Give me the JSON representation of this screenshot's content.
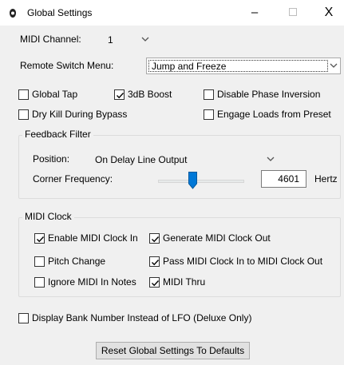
{
  "window": {
    "title": "Global Settings",
    "min_symbol": "–",
    "close_symbol": "X"
  },
  "midi_channel": {
    "label": "MIDI Channel:",
    "value": "1"
  },
  "remote_switch": {
    "label": "Remote Switch Menu:",
    "value": "Jump and Freeze"
  },
  "checkboxes": {
    "global_tap": {
      "label": "Global Tap",
      "checked": false
    },
    "boost_3db": {
      "label": "3dB Boost",
      "checked": true
    },
    "disable_phase": {
      "label": "Disable Phase Inversion",
      "checked": false
    },
    "dry_kill": {
      "label": "Dry Kill During Bypass",
      "checked": false
    },
    "engage_loads": {
      "label": "Engage Loads from Preset",
      "checked": false
    }
  },
  "feedback_filter": {
    "title": "Feedback Filter",
    "position_label": "Position:",
    "position_value": "On Delay Line Output",
    "corner_label": "Corner Frequency:",
    "corner_value": "4601",
    "unit": "Hertz"
  },
  "midi_clock": {
    "title": "MIDI Clock",
    "enable_in": {
      "label": "Enable MIDI Clock In",
      "checked": true
    },
    "generate_out": {
      "label": "Generate MIDI Clock Out",
      "checked": true
    },
    "pitch_change": {
      "label": "Pitch Change",
      "checked": false
    },
    "pass_in_out": {
      "label": "Pass MIDI Clock In to MIDI Clock Out",
      "checked": true
    },
    "ignore_notes": {
      "label": "Ignore MIDI In Notes",
      "checked": false
    },
    "midi_thru": {
      "label": "MIDI Thru",
      "checked": true
    }
  },
  "display_bank": {
    "label": "Display Bank Number Instead of LFO (Deluxe Only)",
    "checked": false
  },
  "reset_button": {
    "label": "Reset Global Settings To Defaults"
  },
  "icons": {
    "app": "app-icon",
    "chevron": "chevron-down-icon",
    "check": "check-icon",
    "slider_thumb": "slider-thumb-icon"
  }
}
